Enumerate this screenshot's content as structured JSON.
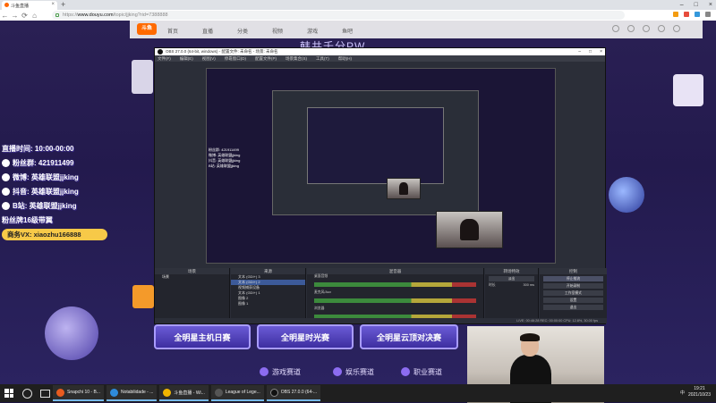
{
  "browser": {
    "tab_title": "斗鱼直播",
    "tab_close": "×",
    "new_tab": "+",
    "window_controls": [
      "–",
      "□",
      "×"
    ],
    "nav": {
      "back": "←",
      "forward": "→",
      "reload": "⟳",
      "home": "⌂"
    },
    "url_host": "www.douyu.com",
    "url_prefix": "https://",
    "url_path": "/topic/jjking?rid=7388888"
  },
  "site": {
    "logo": "斗鱼",
    "nav_items": [
      "首页",
      "直播",
      "分类",
      "视频",
      "游戏",
      "鱼吧"
    ],
    "room_title": "韩共千分PW"
  },
  "overlay": {
    "schedule": "直播时间: 10:00-00:00",
    "lines": [
      {
        "icon": "qq-icon",
        "label": "粉丝群: 421911499"
      },
      {
        "icon": "weibo-icon",
        "label": "微博: 英雄联盟jjking"
      },
      {
        "icon": "douyin-icon",
        "label": "抖音: 英雄联盟jjking"
      },
      {
        "icon": "bilibili-icon",
        "label": "B站: 英雄联盟jjking"
      }
    ],
    "fan_level": "粉丝牌16级带翼",
    "wechat": "商务VX: xiaozhu166888"
  },
  "obs": {
    "title": "OBS 27.0.0 (64-bit, windows) - 配置文件: 未命名 - 场景: 未命名",
    "menu": [
      "文件(F)",
      "编辑(E)",
      "视图(V)",
      "停靠窗口(D)",
      "配置文件(P)",
      "场景集合(S)",
      "工具(T)",
      "帮助(H)"
    ],
    "docks": {
      "scenes": "场景",
      "sources": "来源",
      "mixer": "混音器",
      "transitions": "转场特效",
      "controls": "控制"
    },
    "scene_items": [
      "场景"
    ],
    "source_items": [
      "文本 (GDI+) 3",
      "文本 (GDI+) 2",
      "视频捕获设备",
      "文本 (GDI+) 1",
      "图像 2",
      "图像 1"
    ],
    "mixer_channels": [
      "桌面音频",
      "麦克风/Aux",
      "浏览器"
    ],
    "transition_value": "淡出",
    "duration_label": "时长",
    "duration_value": "300 ms",
    "control_buttons": [
      "停止推流",
      "开始录制",
      "工作室模式",
      "设置",
      "退出"
    ],
    "status": "LIVE: 00:46:28   REC: 00:00:00   CPU: 12.8%, 30.00 fps"
  },
  "promo": {
    "banners": [
      "全明星主机日赛",
      "全明星时光赛",
      "全明星云顶对决赛"
    ],
    "tabs": [
      "游戏赛道",
      "娱乐赛道",
      "职业赛道"
    ]
  },
  "taskbar": {
    "apps": [
      {
        "label": "Snapchi 10 - B...",
        "color": "#e85b1f"
      },
      {
        "label": "Notabilidade - ...",
        "color": "#2e8bdc"
      },
      {
        "label": "斗鱼直播 - Wi...",
        "color": "#f1b600"
      },
      {
        "label": "League of Lege...",
        "color": "#333333"
      },
      {
        "label": "OBS 27.0.0 (64-...",
        "color": "#111111"
      }
    ],
    "time": "19:21",
    "date": "2021/10/23",
    "lang": "中"
  },
  "colors": {
    "accent": "#f7c948",
    "page_bg": "#231a4d",
    "obs_bg": "#2b2e38"
  }
}
